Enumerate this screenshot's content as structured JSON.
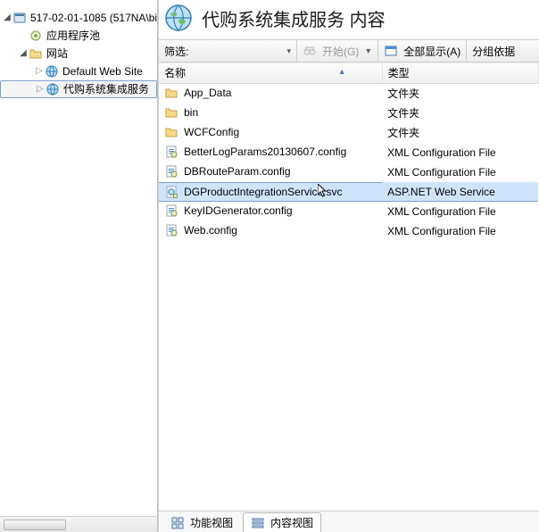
{
  "tree": {
    "root": {
      "label": "517-02-01-1085 (517NA\\bi"
    },
    "app_pool": {
      "label": "应用程序池"
    },
    "sites": {
      "label": "网站"
    },
    "default_site": {
      "label": "Default Web Site"
    },
    "selected_site": {
      "label": "代购系统集成服务"
    }
  },
  "header": {
    "title": "代购系统集成服务 内容"
  },
  "toolbar": {
    "filter_label": "筛选:",
    "filter_value": "",
    "start_label": "开始(G)",
    "show_all_label": "全部显示(A)",
    "group_by_label": "分组依据"
  },
  "columns": {
    "name": "名称",
    "type": "类型"
  },
  "rows": [
    {
      "icon": "folder",
      "name": "App_Data",
      "type": "文件夹",
      "selected": false
    },
    {
      "icon": "folder",
      "name": "bin",
      "type": "文件夹",
      "selected": false
    },
    {
      "icon": "folder",
      "name": "WCFConfig",
      "type": "文件夹",
      "selected": false
    },
    {
      "icon": "config",
      "name": "BetterLogParams20130607.config",
      "type": "XML Configuration File",
      "selected": false
    },
    {
      "icon": "config",
      "name": "DBRouteParam.config",
      "type": "XML Configuration File",
      "selected": false
    },
    {
      "icon": "svc",
      "name": "DGProductIntegrationService.svc",
      "type": "ASP.NET Web Service",
      "selected": true
    },
    {
      "icon": "config",
      "name": "KeyIDGenerator.config",
      "type": "XML Configuration File",
      "selected": false
    },
    {
      "icon": "config",
      "name": "Web.config",
      "type": "XML Configuration File",
      "selected": false
    }
  ],
  "tabs": {
    "features": "功能视图",
    "content": "内容视图"
  }
}
